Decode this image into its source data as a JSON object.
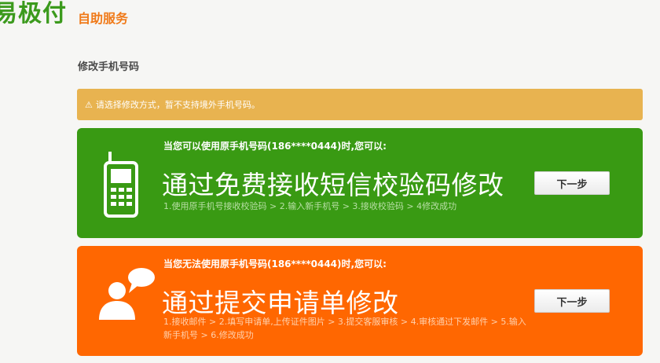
{
  "header": {
    "logo_text": "易极付",
    "service_title": "自助服务"
  },
  "page_title": "修改手机号码",
  "notice": {
    "icon": "warning-icon",
    "text": "请选择修改方式，暂不支持境外手机号码。"
  },
  "options": [
    {
      "condition": "当您可以使用原手机号码(186****0444)时,您可以:",
      "method": "通过免费接收短信校验码修改",
      "steps": "1.使用原手机号接收校验码 > 2.输入新手机号 > 3.接收校验码 > 4修改成功",
      "button": "下一步",
      "icon": "mobile-phone-icon",
      "color": "#399a13"
    },
    {
      "condition": "当您无法使用原手机号码(186****0444)时,您可以:",
      "method": "通过提交申请单修改",
      "steps": "1.接收邮件 > 2.填写申请单,上传证件图片 > 3.提交客服审核 > 4.审核通过下发邮件 > 5.输入新手机号 > 6.修改成功",
      "button": "下一步",
      "icon": "customer-service-icon",
      "color": "#ff6701"
    }
  ],
  "colors": {
    "brand_green": "#3b9a1c",
    "accent_orange": "#f07a19",
    "notice_bg": "#e8b350"
  }
}
